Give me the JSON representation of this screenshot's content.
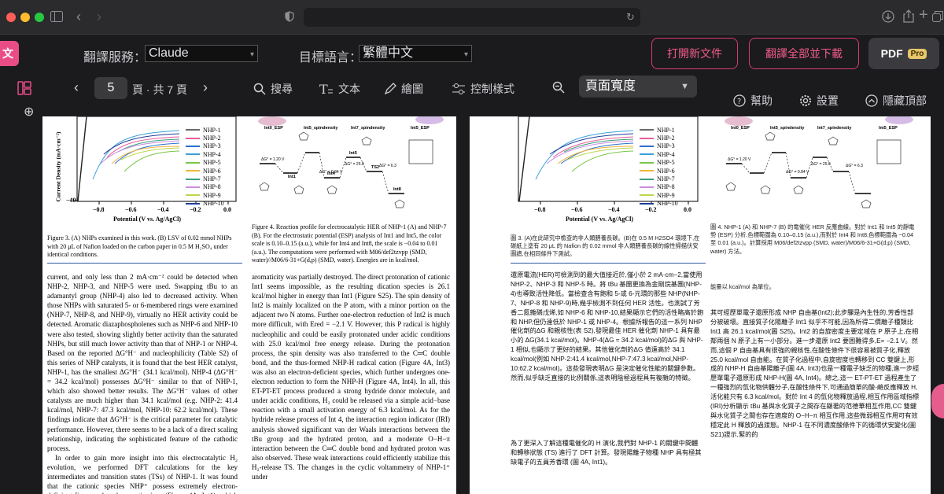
{
  "translation_bar": {
    "service_label": "翻譯服務：",
    "service_value": "Claude",
    "language_label": "目標語言：",
    "language_value": "繁體中文",
    "open_new_button": "打開新文件",
    "translate_all_button": "翻譯全部並下載",
    "pdf_label": "PDF",
    "pro_badge": "Pro"
  },
  "pdf_toolbar": {
    "page_number": "5",
    "page_total": "頁 · 共 7 頁",
    "search": "搜尋",
    "text": "文本",
    "draw": "繪圖",
    "controls": "控制樣式",
    "zoom_value": "頁面寬度",
    "help": "幫助",
    "settings": "設置",
    "hide_top": "隱藏頂部"
  },
  "chart": {
    "ylabel": "Current Density (mA·cm⁻²)",
    "xlabel": "Potential (V vs. Ag/AgCl)",
    "xticks": [
      "−0.8",
      "−0.6",
      "−0.4",
      "−0.2",
      "0.0"
    ],
    "yticks": [
      "0",
      "−40"
    ],
    "legend": [
      "NHP-1",
      "NHP-2",
      "NHP-3",
      "NHP-4",
      "NHP-5",
      "NHP-6",
      "NHP-7",
      "NHP-8",
      "NHP-9",
      "NHP-10"
    ],
    "colors": [
      "#6b6b6b",
      "#e85d9c",
      "#2b6fd0",
      "#3aa1d8",
      "#79c548",
      "#f0b53b",
      "#3aa079",
      "#c98ee0",
      "#bcd74a",
      "#1f3e9a"
    ]
  },
  "scheme": {
    "labels_top": [
      "Int0_ESP",
      "Int5_spindensity",
      "Int7_spindensity",
      "Int5_ESP"
    ],
    "energies": [
      "ΔG° = 1.20 V",
      "ΔG° = 0.84 V",
      "ΔG° = 25.0",
      "ΔG° = 6.3"
    ],
    "states": [
      "Int0",
      "Int1",
      "Int4",
      "Int5",
      "TS2",
      "Int8"
    ]
  },
  "english_left": {
    "figure3_caption": "Figure 3. (A) NHPs examined in this work. (B) LSV of 0.02 mmol NHPs with 20 μL of Nafion loaded on the carbon paper in 0.5 M H₂SO₄ under identical conditions.",
    "figure4_caption": "Figure 4. Reaction profile for electrocatalytic HER of NHP-1 (A) and NHP-7 (B). For the electrostatic potential (ESP) analysis of Int1 and Int5, the color scale is 0.10–0.15 (a.u.), while for Int4 and Int8, the scale is −0.04 to 0.01 (a.u.). The computations were performed with M06/def2tzvpp (SMD, water)//M06/6-31+G(d,p) (SMD, water). Energies are in kcal/mol.",
    "col1_body": "current, and only less than 2 mA·cm⁻² could be detected when NHP-2, NHP-3, and NHP-5 were used. Swapping tBu to an adamantyl group (NHP-4) also led to decreased activity. When those NHPs with saturated 5- or 6-membered rings were examined (NHP-7, NHP-8, and NHP-9), virtually no HER activity could be detected. Aromatic diazaphospholenes such as NHP-6 and NHP-10 were also tested, showing slightly better activity than the saturated NHPs, but still much lower activity than that of NHP-1 or NHP-4. Based on the reported ΔG°H⁻ and nucleophilicity (Table S2) of this series of NHP catalysts, it is found that the best HER catalyst, NHP-1, has the smallest ΔG°H⁻ (34.1 kcal/mol). NHP-4 (ΔG°H⁻ = 34.2 kcal/mol) possesses ΔG°H⁻ similar to that of NHP-1, which also showed better results. The ΔG°H⁻ values of other catalysts are much higher than 34.1 kcal/mol (e.g. NHP-2: 41.4 kcal/mol, NHP-7: 47.3 kcal/mol, NHP-10: 62.2 kcal/mol). These findings indicate that ΔG°H⁻ is the critical parameter for catalytic performance. However, there seems to be a lack of a direct scaling relationship, indicating the sophisticated feature of the cathodic process.",
    "col1_body2": "In order to gain more insight into this electrocatalytic H₂ evolution, we performed DFT calculations for the key intermediates and transition states (TSs) of NHP-1. It was found that the cationic species NHP⁺ possess extremely electron-deficient five-membered aromatic rings (Figure 4A, Int1), which could undergo one-electron reduction to form the",
    "col2_body": "aromaticity was partially destroyed. The direct protonation of cationic Int1 seems impossible, as the resulting dication species is 26.1 kcal/mol higher in energy than Int1 (Figure S25). The spin density of Int2 is mainly localized on the P atom, with a minor portion on the adjacent two N atoms. Further one-electron reduction of Int2 is much more difficult, with Ered = −2.1 V. However, this P radical is highly nucleophilic and could be easily protonated under acidic conditions with 25.0 kcal/mol free energy release. During the protonation process, the spin density was also transferred to the C═C double bond, and the thus-formed NHP-H radical cation (Figure 4A, Int3) was also an electron-deficient species, which further undergoes one-electron reduction to form the NHP-H (Figure 4A, Int4). In all, this ET-PT-ET process produced a strong hydride donor molecule, and under acidic conditions, H₂ could be released via a simple acid−base reaction with a small activation energy of 6.3 kcal/mol. As for the hydride release process of Int 4, the interaction region indicator (IRI) analysis showed significant van der Waals interactions between the tBu group and the hydrated proton, and a moderate O−H−π interaction between the C═C double bond and hydrated proton was also observed. These weak interactions could efficiently stabilize this H₂-release TS. The changes in the cyclic voltammetry of NHP-1⁺ under"
  },
  "chinese_right": {
    "figure3_caption": "圖 3. (A)在此研究中檢查的非人類膳養長碳。(B)在 0.5 M H2SO4 環境下,在碳紙上塗有 20 μL 的 Nafion 的 0.02 mmol 非人類膳養長碳的線性掃描伏安圖譜,在相同條件下測試。",
    "figure4_caption": "圖 4. NHP-1 (A) 和 NHP-7 (B) 的電催化 HER 反應曲線。對於 Int1 和 Int5 的靜電勢 (ESP) 分析,色標範圍為 0.10–0.15 (a.u.),而對於 Int4 和 Int8,色標範圍為 −0.04 至 0.01 (a.u.)。計算採用 M06/def2tzvpp (SMD, water)/M06/6-31+G(d,p) (SMD, water) 方法。",
    "energy_note": "能量以 kcal/mol 為單位。",
    "col1_body": "還原電流(HER)可檢測到的最大值接近於,僅小於 2 mA·cm−2,當使用 NHP-2、NHP-3 和 NHP-5 時。將 tBu 基團更換為金剛烷基團(NHP-4)也導致活性降低。當檢查含有飽和 5-或 6-元環的那些 NHP(NHP-7、NHP-8 和 NHP-9)時,幾乎檢測不到任何 HER 活性。也測試了芳香二氮雜磷戊烯,如 NHP-6 和 NHP-10,結果顯示它們的活性略高於飽和 NHP,但仍遠低於 NHP-1 或 NHP-4。根據所報告的這一系列 NHP 催化劑的ΔG 和親核性(表 S2),發現最佳 HER 催化劑 NHP-1 具有最小的 ΔG(34.1 kcal/mol)。NHP-4(ΔG = 34.2 kcal/mol)的ΔG 與 NHP-1 相似,也顯示了更好的結果。其他催化劑的ΔG 值遠高於 34.1 kcal/mol(例如 NHP-2:41.4 kcal/mol,NHP-7:47.3 kcal/mol,NHP-10:62.2 kcal/mol)。這些發現表明ΔG 是決定催化性能的關鍵參數。然而,似乎缺乏直接的比例關係,這表明陰極過程具有複雜的特徵。",
    "col1_body2": "為了更深入了解這種電催化的 H 演化,我們對 NHP-1 的關鍵中間體和轉移狀態 (TS) 進行了 DFT 計算。發現陽離子物種 NHP 具有極其缺電子的五員芳香環 (圖 4A, Int1)。",
    "col2_body": "其可經歷單電子還原形成 NHP 自由基(Int2);此步驟是內生性的,芳香性部分被破壞。直接質子化陽離子 Int1 似乎不可能,因為所得二價離子種類比 Int1 高 26.1 kcal/mol(圖 S25)。Int2 的自旋密度主要定域在 P 原子上,在相鄰兩個 N 原子上有一小部分。進一步還原 Int2 要困難得多,E= −2.1 V。然而,這個 P 自由基具有很強的親核性,在酸性條件下很容易被質子化,釋放 25.0 kcal/mol 自由能。在質子化過程中,自旋密度也轉移到 CC 雙鍵上,形成的 NHP-H 自由基陽離子(圖 4A, Int3)也是一種電子缺乏的物種,進一步經歷單電子還原形成 NHP-H(圖 4A, Int4)。總之,這一 ET-PT-ET 過程產生了一種強烈的氫化物供體分子,在酸性條件下,可通過簡單的酸-鹼反應釋放 H,活化能只有 6.3 kcal/mol。對於 Int 4 的氫化物釋放過程,相互作用區域指標(IRI)分析顯示 tBu 基與水化質子之間存在顯著的范德華相互作用,CC 雙鍵與水化質子之間也存在適度的 O−H−π 相互作用,這些微弱相互作用可有效穩定此 H 釋放的過渡態。NHP-1 在不同濃度酸條件下的循環伏安變化(圖 S21)證示,緊的的"
  }
}
